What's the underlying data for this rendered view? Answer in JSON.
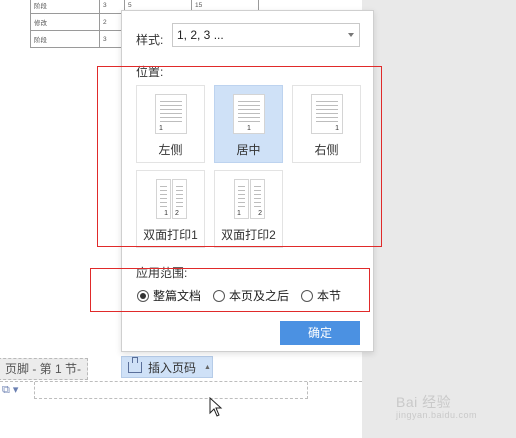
{
  "document": {
    "table_rows": [
      [
        "阶段",
        "3",
        "5",
        "15"
      ],
      [
        "修改",
        "2",
        "",
        ""
      ],
      [
        "阶段",
        "3",
        "",
        ""
      ]
    ],
    "footer_tag": "页脚 - 第 1 节-",
    "insert_page_number_label": "插入页码"
  },
  "panel": {
    "style_label": "样式:",
    "style_value": "1, 2, 3 ...",
    "position_label": "位置:",
    "positions": [
      {
        "label": "左侧",
        "selected": false
      },
      {
        "label": "居中",
        "selected": true
      },
      {
        "label": "右侧",
        "selected": false
      },
      {
        "label": "双面打印1",
        "selected": false
      },
      {
        "label": "双面打印2",
        "selected": false
      }
    ],
    "range_label": "应用范围:",
    "ranges": [
      {
        "label": "整篇文档",
        "selected": true
      },
      {
        "label": "本页及之后",
        "selected": false
      },
      {
        "label": "本节",
        "selected": false
      }
    ],
    "ok_label": "确定",
    "page_num_1": "1",
    "page_num_2": "2"
  },
  "colors": {
    "highlight_red": "#e02a2a",
    "selected_bg": "#cfe1f7",
    "ok_button": "#4b91e2"
  },
  "watermark": {
    "text": "Bai 经验",
    "sub": "jingyan.baidu.com"
  }
}
